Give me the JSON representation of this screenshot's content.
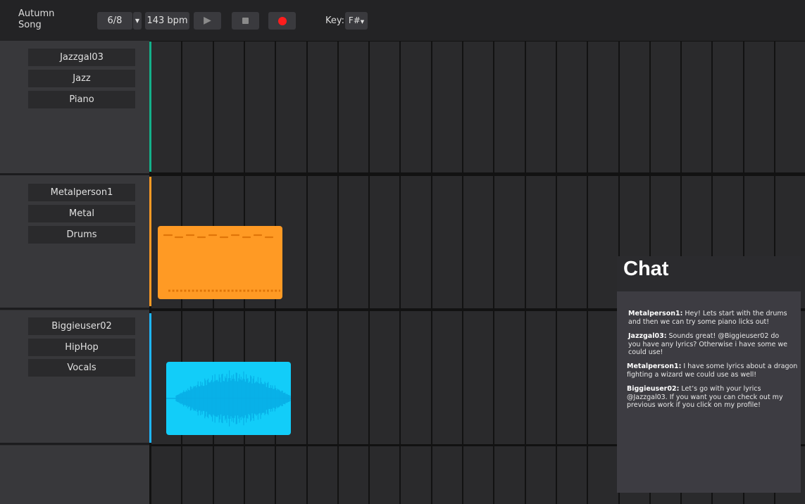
{
  "header": {
    "song_title": "Autumn Song",
    "time_signature": "6/8",
    "tempo": "143 bpm",
    "key_label": "Key:",
    "key_value": "F#",
    "play_icon": "play-icon",
    "stop_icon": "stop-icon",
    "record_icon": "record-icon"
  },
  "tracks": [
    {
      "user": "Jazzgal03",
      "genre": "Jazz",
      "instrument": "Piano",
      "accent_color": "#14b08a"
    },
    {
      "user": "Metalperson1",
      "genre": "Metal",
      "instrument": "Drums",
      "accent_color": "#ff9a24"
    },
    {
      "user": "Biggieuser02",
      "genre": "HipHop",
      "instrument": "Vocals",
      "accent_color": "#1fb6ff"
    }
  ],
  "clips": {
    "drums_color": "#ff9a24",
    "vocals_color": "#12cdf9"
  },
  "chat": {
    "title": "Chat",
    "messages": [
      {
        "author": "Metalperson1:",
        "text": " Hey! Lets start with the drums and then we can try some piano licks out!"
      },
      {
        "author": "Jazzgal03:",
        "text": " Sounds great! @Biggieuser02 do you have any lyrics? Otherwise i have some we could use!"
      },
      {
        "author": "Metalperson1:",
        "text": " I have some lyrics about a dragon fighting a wizard we could use as well!"
      },
      {
        "author": "Biggieuser02:",
        "text": " Let’s go with your lyrics @Jazzgal03. If you want you can check out my previous work if you click on my profile!"
      }
    ]
  }
}
